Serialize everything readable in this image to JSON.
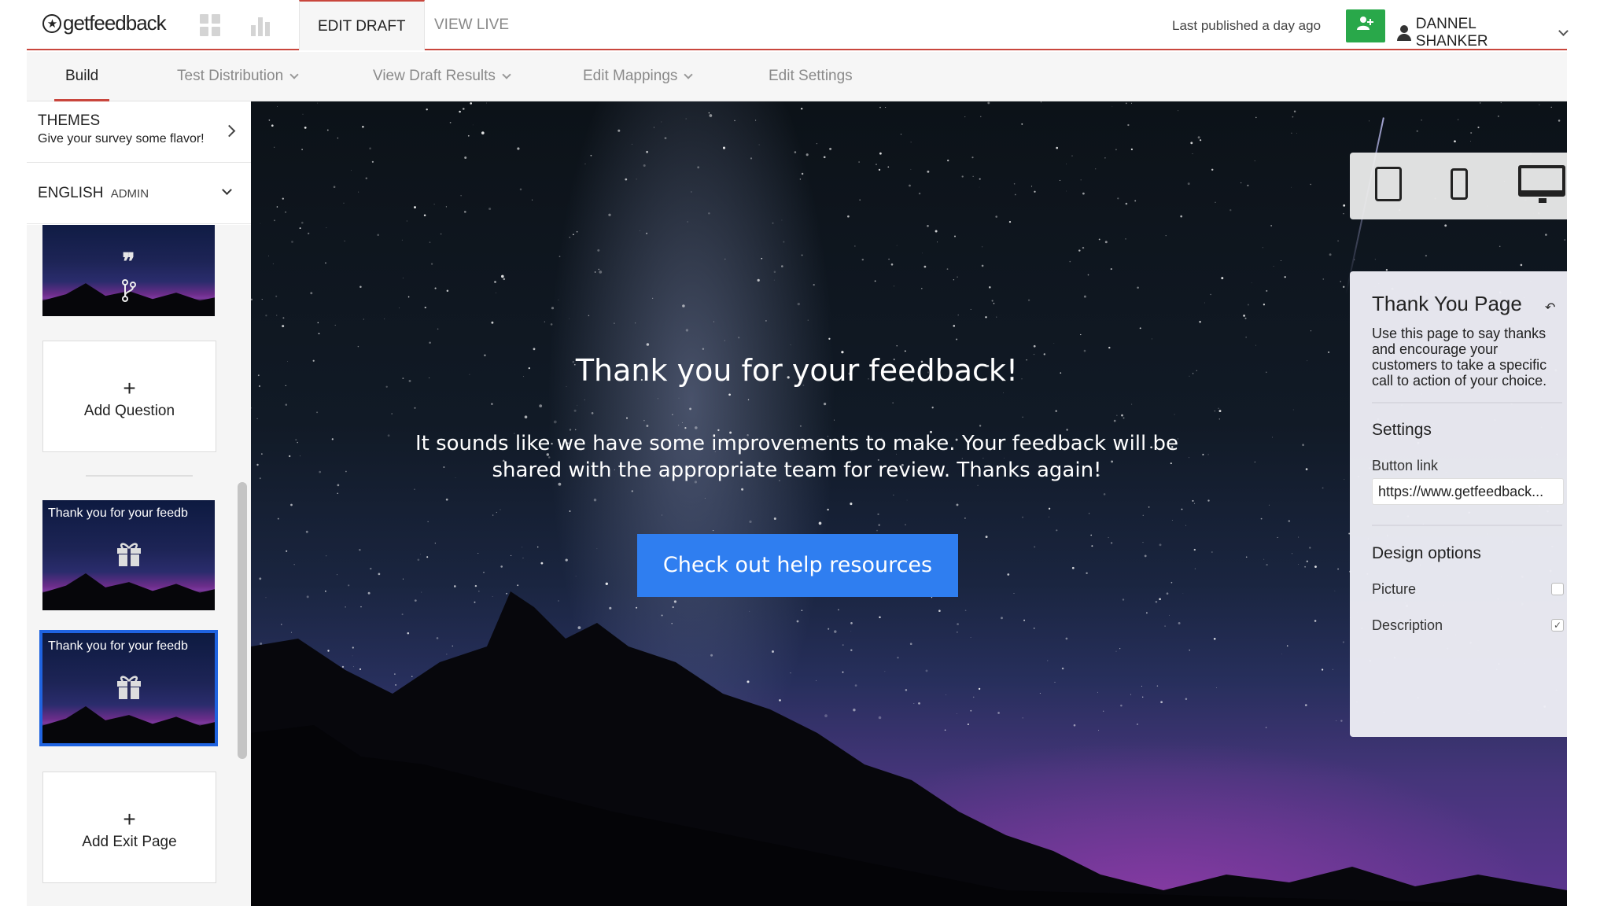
{
  "app": {
    "logo_text": "getfeedback",
    "tabs": [
      "EDIT DRAFT",
      "VIEW LIVE"
    ],
    "last_published": "Last published a day ago",
    "user_name": "DANNEL SHANKER"
  },
  "subnav": {
    "items": [
      "Build",
      "Test Distribution",
      "View Draft Results",
      "Edit Mappings",
      "Edit Settings"
    ]
  },
  "sidebar": {
    "themes_title": "THEMES",
    "themes_subtitle": "Give your survey some flavor!",
    "language": "ENGLISH",
    "language_role": "ADMIN",
    "add_question": "Add Question",
    "add_exit_page": "Add Exit Page",
    "thumbnails": [
      {
        "title": "",
        "icon": "quote-branch-icon"
      },
      {
        "title": "Thank you for your feedb",
        "icon": "gift-icon"
      },
      {
        "title": "Thank you for your feedb",
        "icon": "gift-icon",
        "selected": true
      }
    ]
  },
  "canvas": {
    "title": "Thank you for your feedback!",
    "description": "It sounds like we have some improvements to make. Your feedback will be shared with the appropriate team for review. Thanks again!",
    "button_label": "Check out help resources"
  },
  "panel": {
    "title": "Thank You Page",
    "description": "Use this page to say thanks and encourage your customers to take a specific call to action of your choice.",
    "settings_title": "Settings",
    "button_link_label": "Button link",
    "button_link_value": "https://www.getfeedback...",
    "design_title": "Design options",
    "picture_label": "Picture",
    "picture_checked": false,
    "description_label": "Description",
    "description_checked": true
  },
  "colors": {
    "accent_red": "#c9463d",
    "add_user_green": "#29a84a",
    "cta_blue": "#2f7ef0",
    "selected_blue": "#1f63e0"
  }
}
